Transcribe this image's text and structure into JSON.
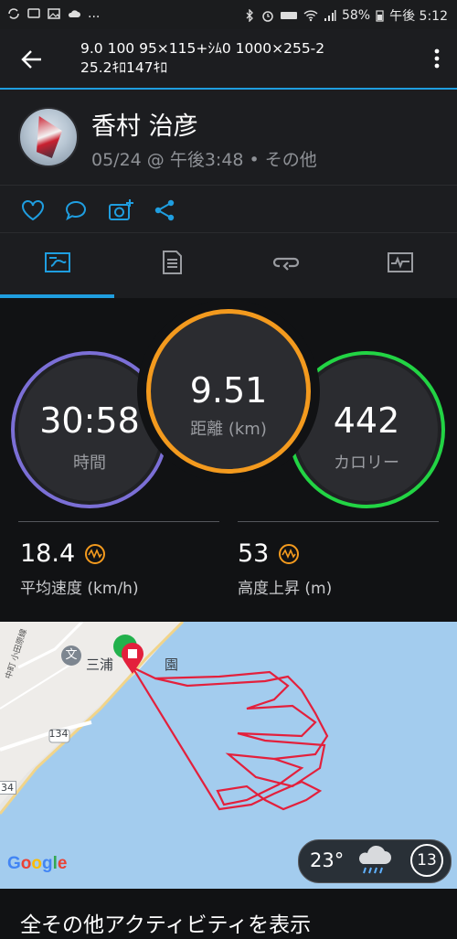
{
  "status_bar": {
    "battery": "58%",
    "time": "午後 5:12",
    "dots": "..."
  },
  "app_bar": {
    "title_line1": "9.0 100 95×115+ｼﾑ0 1000×255-2",
    "title_line2": "25.2ｷﾛ147ｷﾛ"
  },
  "user": {
    "name": "香村 治彦",
    "meta": "05/24 @ 午後3:48 • その他"
  },
  "action_icons": [
    "heart-icon",
    "comment-icon",
    "camera-add-icon",
    "share-icon"
  ],
  "tabs": [
    {
      "name": "tab-overview",
      "icon": "map-overview-icon",
      "selected": true
    },
    {
      "name": "tab-stats",
      "icon": "stats-list-icon",
      "selected": false
    },
    {
      "name": "tab-laps",
      "icon": "laps-icon",
      "selected": false
    },
    {
      "name": "tab-charts",
      "icon": "chart-icon",
      "selected": false
    }
  ],
  "rings": {
    "time": {
      "value": "30:58",
      "label": "時間",
      "color": "#7b6fd6"
    },
    "distance": {
      "value": "9.51",
      "label": "距離 (km)",
      "color": "#f39a1e"
    },
    "calories": {
      "value": "442",
      "label": "カロリー",
      "color": "#22d444"
    }
  },
  "metrics": {
    "avg_speed": {
      "value": "18.4",
      "label": "平均速度 (km/h)"
    },
    "elevation": {
      "value": "53",
      "label": "高度上昇 (m)"
    }
  },
  "map": {
    "place_label": "三浦海岸園",
    "place_label_visible": "三浦",
    "place_label_tail": "園",
    "road_number": "134",
    "road_number_2": "34",
    "school_icon": "文",
    "coast_label": "中町 小田原線",
    "google": "Google",
    "route_color": "#e3203c"
  },
  "weather": {
    "temp": "23°",
    "wind": "13"
  },
  "footer": {
    "show_all": "全その他アクティビティを表示"
  },
  "colors": {
    "accent_blue": "#1f9ee0",
    "background": "#111214"
  }
}
